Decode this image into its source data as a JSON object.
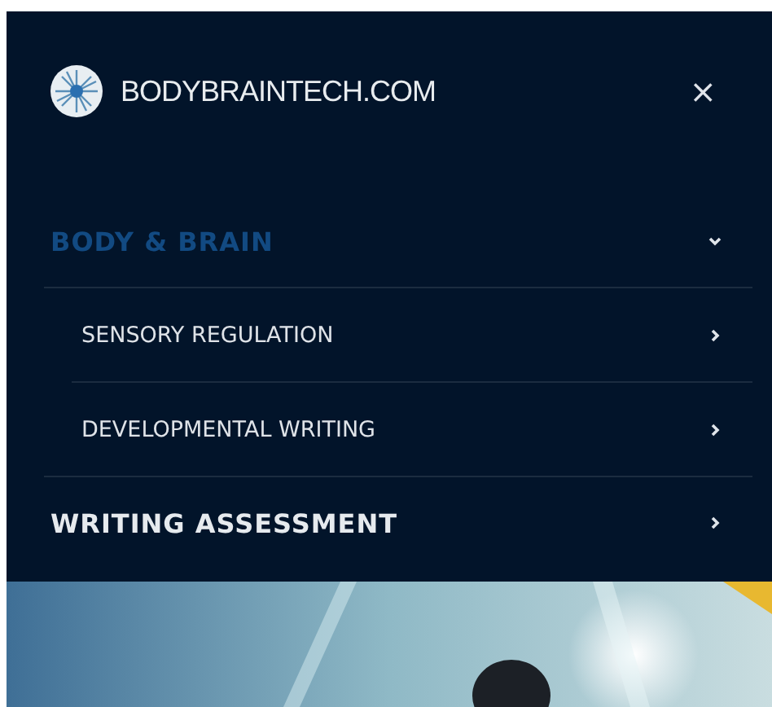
{
  "header": {
    "logo_text": "BODYBRAINTECH.COM",
    "close": "×"
  },
  "menu": [
    {
      "label": "BODY & BRAIN",
      "selected": true,
      "expanded": true,
      "children": [
        {
          "label": "SENSORY REGULATION"
        },
        {
          "label": "DEVELOPMENTAL WRITING"
        }
      ]
    },
    {
      "label": "WRITING ASSESSMENT",
      "selected": false,
      "expanded": false
    }
  ]
}
